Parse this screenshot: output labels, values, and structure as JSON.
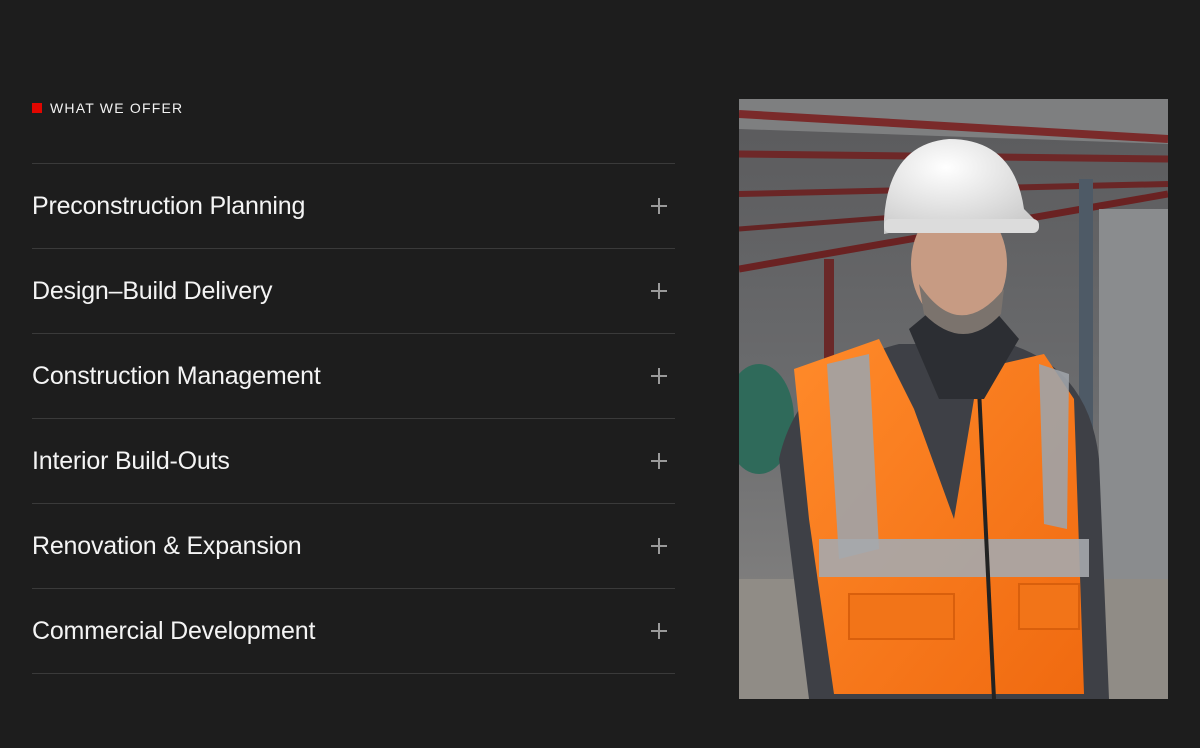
{
  "section": {
    "eyebrow": "WHAT WE OFFER"
  },
  "services": [
    {
      "label": "Preconstruction Planning"
    },
    {
      "label": "Design–Build Delivery"
    },
    {
      "label": "Construction Management"
    },
    {
      "label": "Interior Build-Outs"
    },
    {
      "label": "Renovation & Expansion"
    },
    {
      "label": "Commercial Development"
    }
  ],
  "colors": {
    "background": "#1d1d1d",
    "accent": "#e10600",
    "divider": "#3a3a3a",
    "vest": "#ff7a1a"
  },
  "icons": {
    "expand": "plus-icon"
  }
}
